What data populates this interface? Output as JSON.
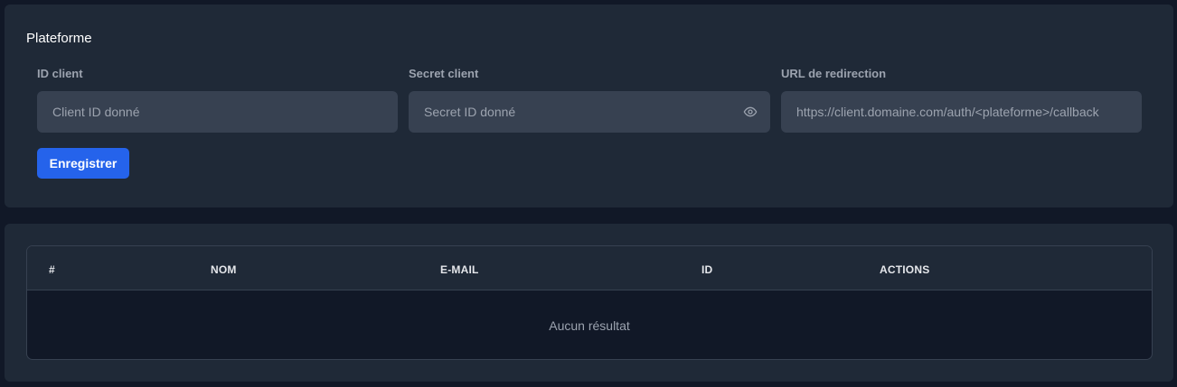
{
  "platform": {
    "title": "Plateforme",
    "client_id": {
      "label": "ID client",
      "placeholder": "Client ID donné",
      "value": ""
    },
    "secret": {
      "label": "Secret client",
      "placeholder": "Secret ID donné",
      "value": ""
    },
    "redirect": {
      "label": "URL de redirection",
      "placeholder": "https://client.domaine.com/auth/<plateforme>/callback",
      "value": ""
    },
    "save_label": "Enregistrer",
    "icons": {
      "toggle_visibility": "eye-icon"
    },
    "colors": {
      "accent": "#2563eb",
      "card": "#1f2937",
      "input": "#374151",
      "background": "#111827"
    }
  },
  "table": {
    "columns": [
      "#",
      "NOM",
      "E-MAIL",
      "ID",
      "ACTIONS"
    ],
    "rows": [],
    "empty_text": "Aucun résultat"
  }
}
